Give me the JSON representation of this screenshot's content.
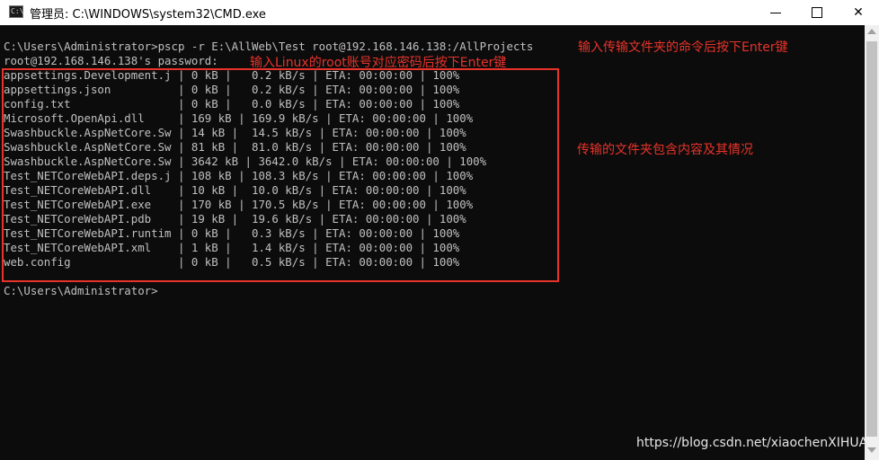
{
  "window": {
    "title": "管理员: C:\\WINDOWS\\system32\\CMD.exe",
    "icon": "cmd-icon",
    "minimize_glyph": "—",
    "close_glyph": "✕"
  },
  "console": {
    "command_line": "C:\\Users\\Administrator>pscp -r E:\\AllWeb\\Test root@192.168.146.138:/AllProjects",
    "password_prompt": "root@192.168.146.138's password:",
    "transfer_rows": [
      "appsettings.Development.j | 0 kB |   0.2 kB/s | ETA: 00:00:00 | 100%",
      "appsettings.json          | 0 kB |   0.2 kB/s | ETA: 00:00:00 | 100%",
      "config.txt                | 0 kB |   0.0 kB/s | ETA: 00:00:00 | 100%",
      "Microsoft.OpenApi.dll     | 169 kB | 169.9 kB/s | ETA: 00:00:00 | 100%",
      "Swashbuckle.AspNetCore.Sw | 14 kB |  14.5 kB/s | ETA: 00:00:00 | 100%",
      "Swashbuckle.AspNetCore.Sw | 81 kB |  81.0 kB/s | ETA: 00:00:00 | 100%",
      "Swashbuckle.AspNetCore.Sw | 3642 kB | 3642.0 kB/s | ETA: 00:00:00 | 100%",
      "Test_NETCoreWebAPI.deps.j | 108 kB | 108.3 kB/s | ETA: 00:00:00 | 100%",
      "Test_NETCoreWebAPI.dll    | 10 kB |  10.0 kB/s | ETA: 00:00:00 | 100%",
      "Test_NETCoreWebAPI.exe    | 170 kB | 170.5 kB/s | ETA: 00:00:00 | 100%",
      "Test_NETCoreWebAPI.pdb    | 19 kB |  19.6 kB/s | ETA: 00:00:00 | 100%",
      "Test_NETCoreWebAPI.runtim | 0 kB |   0.3 kB/s | ETA: 00:00:00 | 100%",
      "Test_NETCoreWebAPI.xml    | 1 kB |   1.4 kB/s | ETA: 00:00:00 | 100%",
      "web.config                | 0 kB |   0.5 kB/s | ETA: 00:00:00 | 100%"
    ],
    "final_prompt": "C:\\Users\\Administrator>"
  },
  "annotations": {
    "command_note": "输入传输文件夹的命令后按下Enter键",
    "password_note": "输入Linux的root账号对应密码后按下Enter键",
    "contents_note": "传输的文件夹包含内容及其情况"
  },
  "watermark": "https://blog.csdn.net/xiaochenXIHUA",
  "colors": {
    "console_bg": "#0c0c0c",
    "console_text": "#c0c0c0",
    "annotation_red": "#e8332a"
  }
}
